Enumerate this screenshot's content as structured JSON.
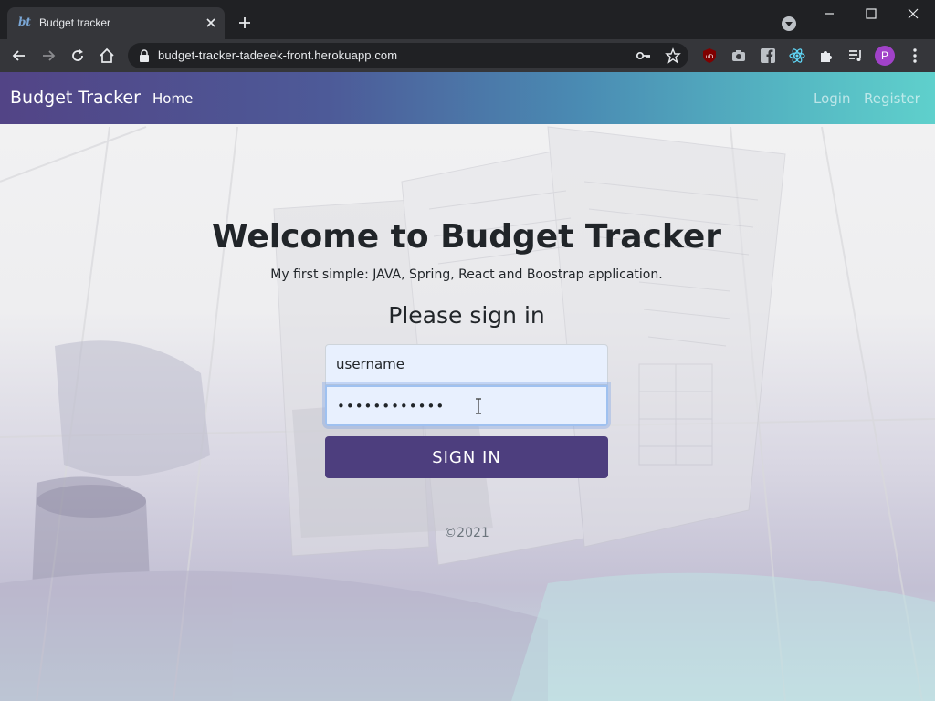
{
  "browser": {
    "tab_title": "Budget tracker",
    "favicon_text": "bt",
    "url": "budget-tracker-tadeeek-front.herokuapp.com",
    "profile_initial": "P",
    "icons": [
      "back-icon",
      "forward-icon",
      "reload-icon",
      "home-icon",
      "lock-icon",
      "key-icon",
      "star-icon",
      "ublock-icon",
      "camera-icon",
      "facebook-icon",
      "react-icon",
      "extensions-icon",
      "media-icon",
      "menu-icon"
    ]
  },
  "navbar": {
    "brand": "Budget Tracker",
    "home": "Home",
    "login": "Login",
    "register": "Register"
  },
  "main": {
    "headline": "Welcome to Budget Tracker",
    "subline": "My first simple: JAVA, Spring, React and Boostrap application.",
    "signin_title": "Please sign in",
    "username_value": "username",
    "password_value": "••••••••••••",
    "signin_button": "SIGN IN"
  },
  "footer": {
    "text": "©2021"
  },
  "colors": {
    "navbar_start": "#524486",
    "navbar_end": "#5fd0cc",
    "button": "#4d3e7e",
    "input_bg": "#e8f0fe"
  }
}
